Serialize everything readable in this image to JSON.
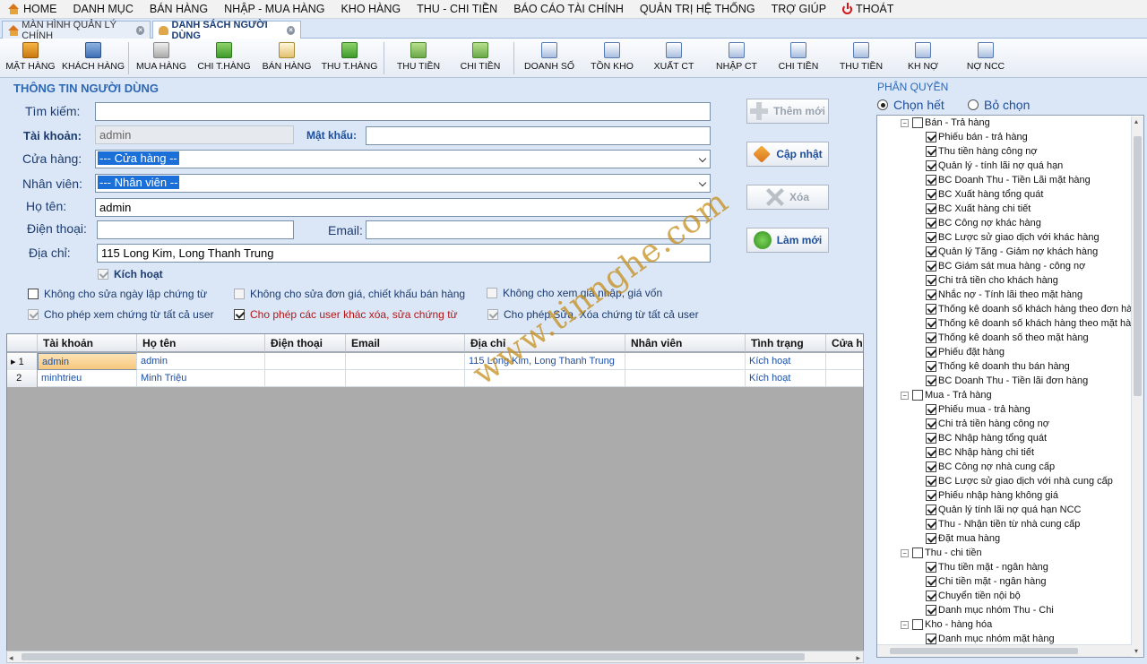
{
  "menu": [
    "HOME",
    "DANH MỤC",
    "BÁN HÀNG",
    "NHẬP - MUA HÀNG",
    "KHO HÀNG",
    "THU - CHI TIỀN",
    "BÁO CÁO TÀI CHÍNH",
    "QUẢN TRỊ HỆ THỐNG",
    "TRỢ GIÚP",
    "THOÁT"
  ],
  "tabs": [
    "MÀN HÌNH QUẢN LÝ CHÍNH",
    "DANH SÁCH NGƯỜI DÙNG"
  ],
  "toolbar": [
    "MẶT HÀNG",
    "KHÁCH HÀNG",
    "MUA HÀNG",
    "CHI T.HÀNG",
    "BÁN HÀNG",
    "THU T.HÀNG",
    "THU TIỀN",
    "CHI TIỀN",
    "DOANH SỐ",
    "TỒN KHO",
    "XUẤT CT",
    "NHẬP CT",
    "CHI TIỀN",
    "THU TIỀN",
    "KH NỢ",
    "NỢ NCC"
  ],
  "form": {
    "section_title": "THÔNG TIN NGƯỜI DÙNG",
    "search_label": "Tìm kiếm:",
    "search_value": "",
    "account_label": "Tài khoản:",
    "account_value": "admin",
    "password_label": "Mật khẩu:",
    "password_value": "",
    "store_label": "Cửa hàng:",
    "store_value": "--- Cửa hàng --",
    "employee_label": "Nhân viên:",
    "employee_value": "--- Nhân viên --",
    "fullname_label": "Họ tên:",
    "fullname_value": "admin",
    "phone_label": "Điện thoại:",
    "phone_value": "",
    "email_label": "Email:",
    "email_value": "",
    "address_label": "Địa chỉ:",
    "address_value": "115 Long Kim, Long Thanh Trung",
    "active_label": "Kích hoạt"
  },
  "buttons": {
    "add": "Thêm mới",
    "update": "Cập nhật",
    "delete": "Xóa",
    "refresh": "Làm mới"
  },
  "options": [
    "Không cho sửa ngày lập chứng từ",
    "Không cho sửa đơn giá, chiết khấu bán hàng",
    "Không cho xem giá nhập, giá vốn",
    "Cho phép xem chứng từ tất cả user",
    "Cho phép các user khác xóa, sửa chứng từ",
    "Cho phép Sửa, Xóa chứng từ tất cả user"
  ],
  "grid": {
    "columns": [
      "Tài khoản",
      "Họ tên",
      "Điện thoại",
      "Email",
      "Địa chỉ",
      "Nhân viên",
      "Tình trạng",
      "Cửa hàng"
    ],
    "rows": [
      {
        "num": "1",
        "account": "admin",
        "name": "admin",
        "phone": "",
        "email": "",
        "address": "115 Long Kim, Long Thanh Trung",
        "employee": "",
        "status": "Kích hoạt"
      },
      {
        "num": "2",
        "account": "minhtrieu",
        "name": "Minh Triệu",
        "phone": "",
        "email": "",
        "address": "",
        "employee": "",
        "status": "Kích hoạt"
      }
    ]
  },
  "permissions": {
    "title": "PHÂN QUYỀN",
    "select_all": "Chọn hết",
    "deselect": "Bỏ chọn",
    "groups": [
      {
        "name": "Bán - Trả hàng",
        "items": [
          "Phiếu bán - trả hàng",
          "Thu tiền hàng công nợ",
          "Quản lý - tính lãi nợ quá hạn",
          "BC Doanh Thu - Tiền Lãi mặt hàng",
          "BC Xuất hàng tổng quát",
          "BC Xuất hàng chi tiết",
          "BC Công nợ khác hàng",
          "BC Lược sử giao dịch với khác hàng",
          "Quản lý Tăng - Giảm nợ khách hàng",
          "BC Giám sát mua hàng - công nợ",
          "Chi trả tiền cho khách hàng",
          "Nhắc nợ - Tính lãi theo mặt hàng",
          "Thống kê doanh số khách hàng theo đơn hàng",
          "Thống kê doanh số khách hàng theo mặt hàng",
          "Thống kê doanh số theo mặt hàng",
          "Phiếu đặt hàng",
          "Thống kê doanh thu bán hàng",
          "BC Doanh Thu - Tiền lãi đơn hàng"
        ]
      },
      {
        "name": "Mua - Trả hàng",
        "items": [
          "Phiếu mua - trả hàng",
          "Chi trả tiền hàng công nợ",
          "BC Nhập hàng tổng quát",
          "BC Nhập hàng chi tiết",
          "BC Công nợ nhà cung cấp",
          "BC Lược sử giao dịch với nhà cung cấp",
          "Phiếu nhập hàng không giá",
          "Quản lý tính lãi nợ quá hạn NCC",
          "Thu - Nhận tiền từ nhà cung cấp",
          "Đặt mua hàng"
        ]
      },
      {
        "name": "Thu - chi tiền",
        "items": [
          "Thu tiền mặt - ngân hàng",
          "Chi tiền mặt - ngân hàng",
          "Chuyển tiền nội bộ",
          "Danh mục nhóm Thu - Chi"
        ]
      },
      {
        "name": "Kho - hàng hóa",
        "items": [
          "Danh mục nhóm mặt hàng"
        ]
      }
    ]
  },
  "watermark": "www.tinnghe.com",
  "colors": {
    "accent": "#2d68b5",
    "panel": "#dbe7f7",
    "selected_row": "#f6c77c",
    "danger": "#b41616"
  }
}
